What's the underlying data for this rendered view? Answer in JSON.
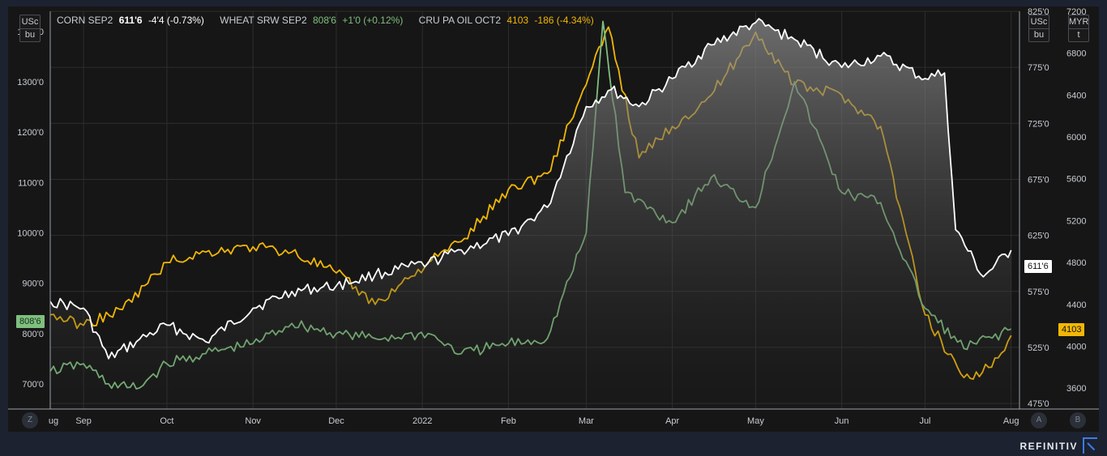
{
  "legend": {
    "corn": {
      "name": "CORN SEP2",
      "value": "611'6",
      "change": "-4'4 (-0.73%)",
      "color": "#ffffff"
    },
    "wheat": {
      "name": "WHEAT SRW SEP2",
      "value": "808'6",
      "change": "+1'0 (+0.12%)",
      "color": "#7fbf7f"
    },
    "palm": {
      "name": "CRU PA OIL OCT2",
      "value": "4103",
      "change": "-186 (-4.34%)",
      "color": "#f2b705"
    }
  },
  "units": {
    "left": {
      "top": "USc",
      "bottom": "bu"
    },
    "right1": {
      "top": "USc",
      "bottom": "bu"
    },
    "right2": {
      "top": "MYR",
      "bottom": "t"
    }
  },
  "tags": {
    "wheat_last": "808'6",
    "corn_last": "611'6",
    "palm_last": "4103"
  },
  "axis_buttons": {
    "left": "Z",
    "right1": "A",
    "right2": "B"
  },
  "brand": "REFINITIV",
  "chart_data": {
    "type": "line",
    "x_ticks": [
      "ug",
      "Sep",
      "Oct",
      "Nov",
      "Dec",
      "2022",
      "Feb",
      "Mar",
      "Apr",
      "May",
      "Jun",
      "Jul",
      "Aug"
    ],
    "left_axis": {
      "ticks": [
        "700'0",
        "800'0",
        "900'0",
        "1000'0",
        "1100'0",
        "1200'0",
        "1300'0",
        "1400'0"
      ],
      "range": [
        650,
        1440
      ]
    },
    "right_axis_1": {
      "ticks": [
        "475'0",
        "525'0",
        "575'0",
        "625'0",
        "675'0",
        "725'0",
        "775'0",
        "825'0"
      ],
      "range": [
        470,
        825
      ]
    },
    "right_axis_2": {
      "ticks": [
        "3600",
        "4000",
        "4400",
        "4800",
        "5200",
        "5600",
        "6000",
        "6400",
        "6800",
        "7200"
      ],
      "range": [
        3400,
        7200
      ]
    },
    "grid": true,
    "series": [
      {
        "name": "CORN SEP2",
        "axis": "right_axis_1",
        "color": "#ffffff",
        "fill": true,
        "points": [
          [
            "2021-08-20",
            566
          ],
          [
            "2021-09-01",
            560
          ],
          [
            "2021-09-10",
            515
          ],
          [
            "2021-09-20",
            530
          ],
          [
            "2021-10-01",
            545
          ],
          [
            "2021-10-15",
            530
          ],
          [
            "2021-11-01",
            560
          ],
          [
            "2021-11-15",
            575
          ],
          [
            "2021-12-01",
            580
          ],
          [
            "2021-12-15",
            590
          ],
          [
            "2022-01-03",
            600
          ],
          [
            "2022-01-15",
            612
          ],
          [
            "2022-02-01",
            625
          ],
          [
            "2022-02-15",
            650
          ],
          [
            "2022-03-01",
            740
          ],
          [
            "2022-03-10",
            755
          ],
          [
            "2022-03-20",
            740
          ],
          [
            "2022-04-01",
            765
          ],
          [
            "2022-04-15",
            795
          ],
          [
            "2022-05-01",
            815
          ],
          [
            "2022-05-15",
            800
          ],
          [
            "2022-06-01",
            775
          ],
          [
            "2022-06-15",
            785
          ],
          [
            "2022-07-01",
            765
          ],
          [
            "2022-07-08",
            770
          ],
          [
            "2022-07-12",
            630
          ],
          [
            "2022-07-22",
            588
          ],
          [
            "2022-08-01",
            611.75
          ]
        ]
      },
      {
        "name": "WHEAT SRW SEP2",
        "axis": "left_axis",
        "color": "#7fbf7f",
        "points": [
          [
            "2021-08-20",
            725
          ],
          [
            "2021-09-01",
            740
          ],
          [
            "2021-09-10",
            700
          ],
          [
            "2021-09-20",
            690
          ],
          [
            "2021-10-01",
            740
          ],
          [
            "2021-10-15",
            760
          ],
          [
            "2021-11-01",
            780
          ],
          [
            "2021-11-15",
            820
          ],
          [
            "2021-12-01",
            800
          ],
          [
            "2021-12-15",
            790
          ],
          [
            "2022-01-03",
            800
          ],
          [
            "2022-01-15",
            760
          ],
          [
            "2022-02-01",
            780
          ],
          [
            "2022-02-15",
            790
          ],
          [
            "2022-03-01",
            1000
          ],
          [
            "2022-03-07",
            1420
          ],
          [
            "2022-03-15",
            1080
          ],
          [
            "2022-04-01",
            1020
          ],
          [
            "2022-04-15",
            1110
          ],
          [
            "2022-05-01",
            1050
          ],
          [
            "2022-05-15",
            1300
          ],
          [
            "2022-06-01",
            1080
          ],
          [
            "2022-06-15",
            1060
          ],
          [
            "2022-07-01",
            850
          ],
          [
            "2022-07-15",
            770
          ],
          [
            "2022-08-01",
            808.75
          ]
        ]
      },
      {
        "name": "CRU PA OIL OCT2",
        "axis": "right_axis_2",
        "color": "#f2b705",
        "points": [
          [
            "2021-08-20",
            4300
          ],
          [
            "2021-09-01",
            4200
          ],
          [
            "2021-09-15",
            4350
          ],
          [
            "2021-10-01",
            4800
          ],
          [
            "2021-10-15",
            4900
          ],
          [
            "2021-11-01",
            4950
          ],
          [
            "2021-11-15",
            4900
          ],
          [
            "2021-12-01",
            4700
          ],
          [
            "2021-12-15",
            4400
          ],
          [
            "2022-01-03",
            4800
          ],
          [
            "2022-01-15",
            5000
          ],
          [
            "2022-02-01",
            5500
          ],
          [
            "2022-02-15",
            5650
          ],
          [
            "2022-03-01",
            6500
          ],
          [
            "2022-03-09",
            7050
          ],
          [
            "2022-03-20",
            5800
          ],
          [
            "2022-04-01",
            6100
          ],
          [
            "2022-04-15",
            6400
          ],
          [
            "2022-05-01",
            7000
          ],
          [
            "2022-05-15",
            6500
          ],
          [
            "2022-06-01",
            6400
          ],
          [
            "2022-06-15",
            6100
          ],
          [
            "2022-07-01",
            4300
          ],
          [
            "2022-07-15",
            3700
          ],
          [
            "2022-07-25",
            3800
          ],
          [
            "2022-08-01",
            4103
          ]
        ]
      }
    ]
  }
}
